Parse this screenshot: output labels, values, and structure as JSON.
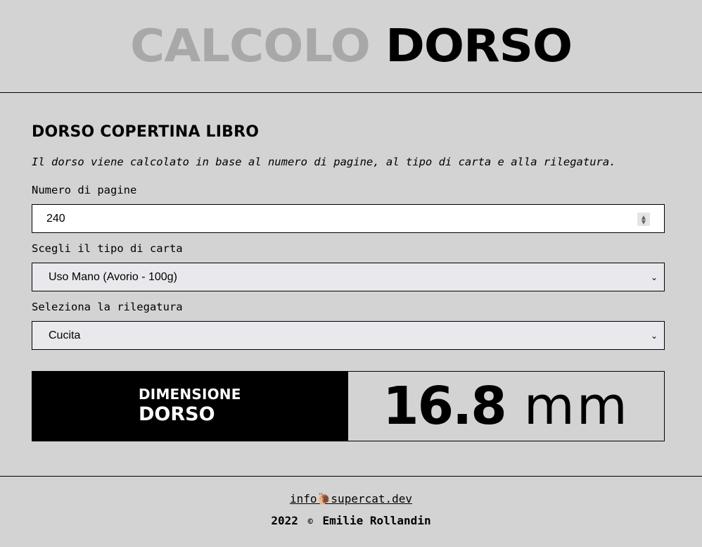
{
  "header": {
    "title_part1": "CALCOLO",
    "title_part2": "DORSO",
    "title_part1_color": "#a8a8a8",
    "title_part2_color": "#000000"
  },
  "main": {
    "section_title": "DORSO COPERTINA LIBRO",
    "description": "Il dorso viene calcolato in base al numero di pagine, al tipo di carta e alla rilegatura.",
    "pages": {
      "label": "Numero di pagine",
      "value": "240"
    },
    "paper": {
      "label": "Scegli il tipo di carta",
      "selected": "Uso Mano (Avorio - 100g)"
    },
    "binding": {
      "label": "Seleziona la rilegatura",
      "selected": "Cucita"
    },
    "result": {
      "label_line1": "DIMENSIONE",
      "label_line2": "DORSO",
      "value": "16.8",
      "unit": "mm"
    }
  },
  "footer": {
    "email": "info🐌supercat.dev",
    "year": "2022",
    "copyright_symbol": "©",
    "author": "Emilie Rollandin"
  },
  "colors": {
    "background": "#d3d3d3",
    "input_bg": "#ffffff",
    "select_bg": "#e9e9ed",
    "result_label_bg": "#000000"
  }
}
